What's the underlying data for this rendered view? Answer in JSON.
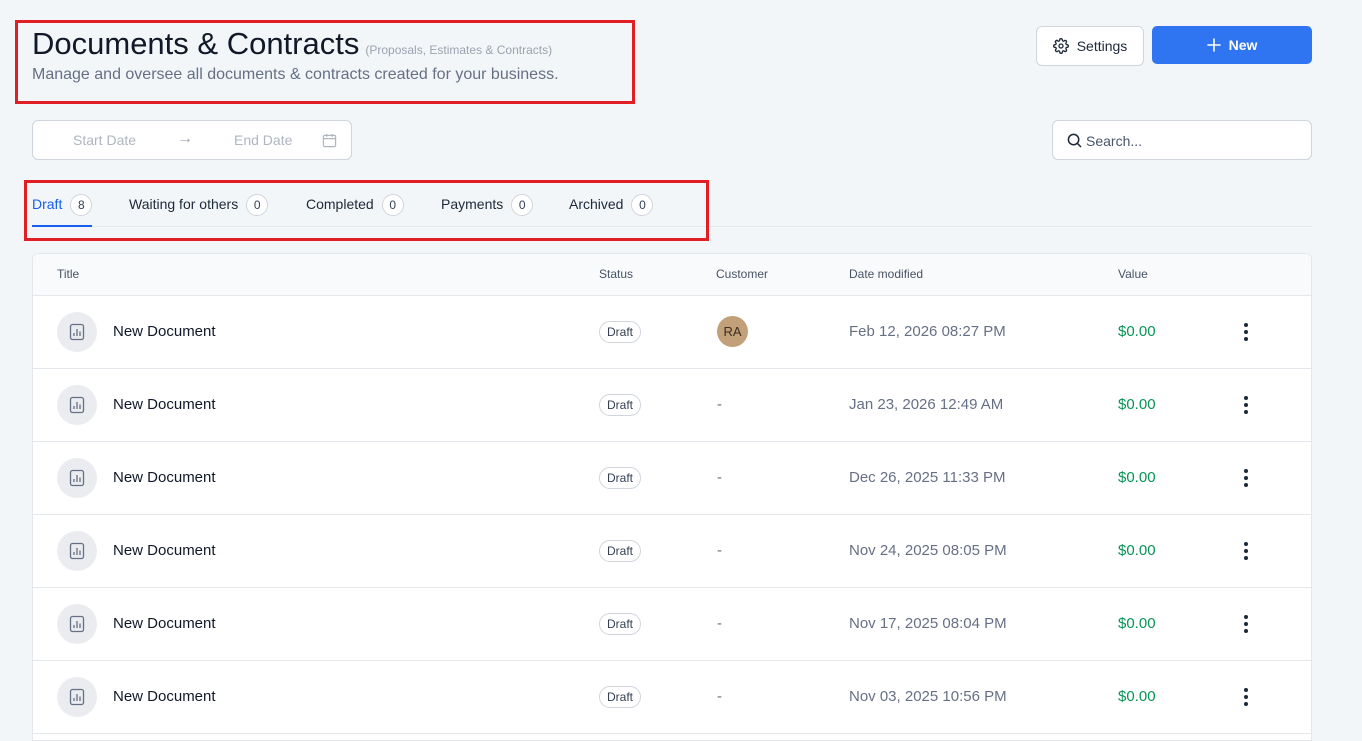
{
  "header": {
    "title": "Documents & Contracts",
    "title_note": "(Proposals, Estimates & Contracts)",
    "description": "Manage and oversee all documents & contracts created for your business."
  },
  "toolbar": {
    "settings_label": "Settings",
    "new_label": "New"
  },
  "filters": {
    "start_date_placeholder": "Start Date",
    "end_date_placeholder": "End Date",
    "search_placeholder": "Search..."
  },
  "tabs": [
    {
      "label": "Draft",
      "count": "8",
      "active": true
    },
    {
      "label": "Waiting for others",
      "count": "0",
      "active": false
    },
    {
      "label": "Completed",
      "count": "0",
      "active": false
    },
    {
      "label": "Payments",
      "count": "0",
      "active": false
    },
    {
      "label": "Archived",
      "count": "0",
      "active": false
    }
  ],
  "table": {
    "columns": [
      "Title",
      "Status",
      "Customer",
      "Date modified",
      "Value"
    ],
    "rows": [
      {
        "title": "New Document",
        "status": "Draft",
        "customer": "RA",
        "date": "Feb 12, 2026 08:27 PM",
        "value": "$0.00"
      },
      {
        "title": "New Document",
        "status": "Draft",
        "customer": "-",
        "date": "Jan 23, 2026 12:49 AM",
        "value": "$0.00"
      },
      {
        "title": "New Document",
        "status": "Draft",
        "customer": "-",
        "date": "Dec 26, 2025 11:33 PM",
        "value": "$0.00"
      },
      {
        "title": "New Document",
        "status": "Draft",
        "customer": "-",
        "date": "Nov 24, 2025 08:05 PM",
        "value": "$0.00"
      },
      {
        "title": "New Document",
        "status": "Draft",
        "customer": "-",
        "date": "Nov 17, 2025 08:04 PM",
        "value": "$0.00"
      },
      {
        "title": "New Document",
        "status": "Draft",
        "customer": "-",
        "date": "Nov 03, 2025 10:56 PM",
        "value": "$0.00"
      }
    ]
  },
  "colors": {
    "accent": "#2f74f0",
    "active_tab": "#155eef",
    "value_green": "#079455",
    "highlight_red": "#e01e24",
    "avatar_bg": "#c2a079"
  },
  "icons": {
    "settings": "gear-icon",
    "new": "plus-icon",
    "date_arrow": "arrow-right-icon",
    "calendar": "calendar-icon",
    "search": "search-icon",
    "document": "document-chart-icon",
    "row_menu": "more-vertical-icon"
  }
}
